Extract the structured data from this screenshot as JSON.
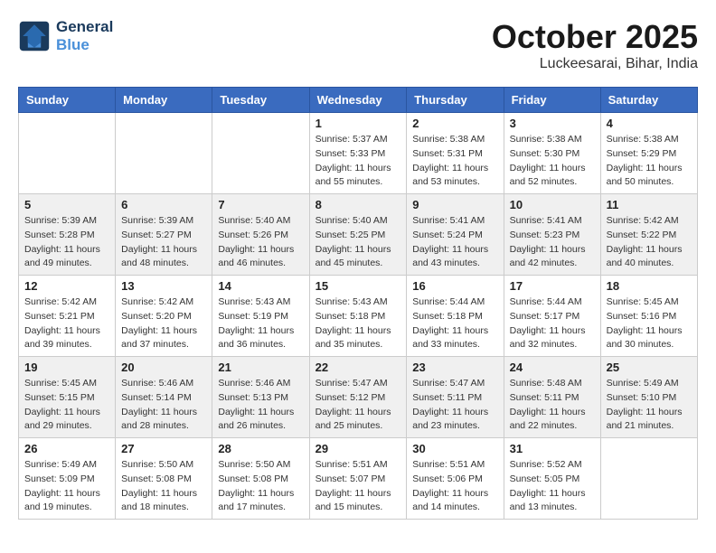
{
  "header": {
    "logo_line1": "General",
    "logo_line2": "Blue",
    "month": "October 2025",
    "location": "Luckeesarai, Bihar, India"
  },
  "weekdays": [
    "Sunday",
    "Monday",
    "Tuesday",
    "Wednesday",
    "Thursday",
    "Friday",
    "Saturday"
  ],
  "weeks": [
    [
      {
        "day": "",
        "info": ""
      },
      {
        "day": "",
        "info": ""
      },
      {
        "day": "",
        "info": ""
      },
      {
        "day": "1",
        "info": "Sunrise: 5:37 AM\nSunset: 5:33 PM\nDaylight: 11 hours\nand 55 minutes."
      },
      {
        "day": "2",
        "info": "Sunrise: 5:38 AM\nSunset: 5:31 PM\nDaylight: 11 hours\nand 53 minutes."
      },
      {
        "day": "3",
        "info": "Sunrise: 5:38 AM\nSunset: 5:30 PM\nDaylight: 11 hours\nand 52 minutes."
      },
      {
        "day": "4",
        "info": "Sunrise: 5:38 AM\nSunset: 5:29 PM\nDaylight: 11 hours\nand 50 minutes."
      }
    ],
    [
      {
        "day": "5",
        "info": "Sunrise: 5:39 AM\nSunset: 5:28 PM\nDaylight: 11 hours\nand 49 minutes."
      },
      {
        "day": "6",
        "info": "Sunrise: 5:39 AM\nSunset: 5:27 PM\nDaylight: 11 hours\nand 48 minutes."
      },
      {
        "day": "7",
        "info": "Sunrise: 5:40 AM\nSunset: 5:26 PM\nDaylight: 11 hours\nand 46 minutes."
      },
      {
        "day": "8",
        "info": "Sunrise: 5:40 AM\nSunset: 5:25 PM\nDaylight: 11 hours\nand 45 minutes."
      },
      {
        "day": "9",
        "info": "Sunrise: 5:41 AM\nSunset: 5:24 PM\nDaylight: 11 hours\nand 43 minutes."
      },
      {
        "day": "10",
        "info": "Sunrise: 5:41 AM\nSunset: 5:23 PM\nDaylight: 11 hours\nand 42 minutes."
      },
      {
        "day": "11",
        "info": "Sunrise: 5:42 AM\nSunset: 5:22 PM\nDaylight: 11 hours\nand 40 minutes."
      }
    ],
    [
      {
        "day": "12",
        "info": "Sunrise: 5:42 AM\nSunset: 5:21 PM\nDaylight: 11 hours\nand 39 minutes."
      },
      {
        "day": "13",
        "info": "Sunrise: 5:42 AM\nSunset: 5:20 PM\nDaylight: 11 hours\nand 37 minutes."
      },
      {
        "day": "14",
        "info": "Sunrise: 5:43 AM\nSunset: 5:19 PM\nDaylight: 11 hours\nand 36 minutes."
      },
      {
        "day": "15",
        "info": "Sunrise: 5:43 AM\nSunset: 5:18 PM\nDaylight: 11 hours\nand 35 minutes."
      },
      {
        "day": "16",
        "info": "Sunrise: 5:44 AM\nSunset: 5:18 PM\nDaylight: 11 hours\nand 33 minutes."
      },
      {
        "day": "17",
        "info": "Sunrise: 5:44 AM\nSunset: 5:17 PM\nDaylight: 11 hours\nand 32 minutes."
      },
      {
        "day": "18",
        "info": "Sunrise: 5:45 AM\nSunset: 5:16 PM\nDaylight: 11 hours\nand 30 minutes."
      }
    ],
    [
      {
        "day": "19",
        "info": "Sunrise: 5:45 AM\nSunset: 5:15 PM\nDaylight: 11 hours\nand 29 minutes."
      },
      {
        "day": "20",
        "info": "Sunrise: 5:46 AM\nSunset: 5:14 PM\nDaylight: 11 hours\nand 28 minutes."
      },
      {
        "day": "21",
        "info": "Sunrise: 5:46 AM\nSunset: 5:13 PM\nDaylight: 11 hours\nand 26 minutes."
      },
      {
        "day": "22",
        "info": "Sunrise: 5:47 AM\nSunset: 5:12 PM\nDaylight: 11 hours\nand 25 minutes."
      },
      {
        "day": "23",
        "info": "Sunrise: 5:47 AM\nSunset: 5:11 PM\nDaylight: 11 hours\nand 23 minutes."
      },
      {
        "day": "24",
        "info": "Sunrise: 5:48 AM\nSunset: 5:11 PM\nDaylight: 11 hours\nand 22 minutes."
      },
      {
        "day": "25",
        "info": "Sunrise: 5:49 AM\nSunset: 5:10 PM\nDaylight: 11 hours\nand 21 minutes."
      }
    ],
    [
      {
        "day": "26",
        "info": "Sunrise: 5:49 AM\nSunset: 5:09 PM\nDaylight: 11 hours\nand 19 minutes."
      },
      {
        "day": "27",
        "info": "Sunrise: 5:50 AM\nSunset: 5:08 PM\nDaylight: 11 hours\nand 18 minutes."
      },
      {
        "day": "28",
        "info": "Sunrise: 5:50 AM\nSunset: 5:08 PM\nDaylight: 11 hours\nand 17 minutes."
      },
      {
        "day": "29",
        "info": "Sunrise: 5:51 AM\nSunset: 5:07 PM\nDaylight: 11 hours\nand 15 minutes."
      },
      {
        "day": "30",
        "info": "Sunrise: 5:51 AM\nSunset: 5:06 PM\nDaylight: 11 hours\nand 14 minutes."
      },
      {
        "day": "31",
        "info": "Sunrise: 5:52 AM\nSunset: 5:05 PM\nDaylight: 11 hours\nand 13 minutes."
      },
      {
        "day": "",
        "info": ""
      }
    ]
  ]
}
